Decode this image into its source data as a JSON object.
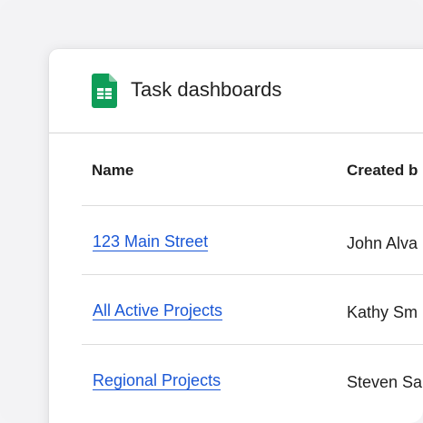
{
  "header": {
    "title": "Task dashboards",
    "icon": "google-sheets-icon"
  },
  "table": {
    "columns": [
      "Name",
      "Created b"
    ],
    "rows": [
      {
        "name": "123 Main Street",
        "created_by": "John Alva"
      },
      {
        "name": "All Active Projects",
        "created_by": "Kathy Sm"
      },
      {
        "name": "Regional Projects",
        "created_by": "Steven Sa"
      }
    ]
  },
  "colors": {
    "link": "#1a57d6",
    "sheets_green": "#0f9d58"
  }
}
